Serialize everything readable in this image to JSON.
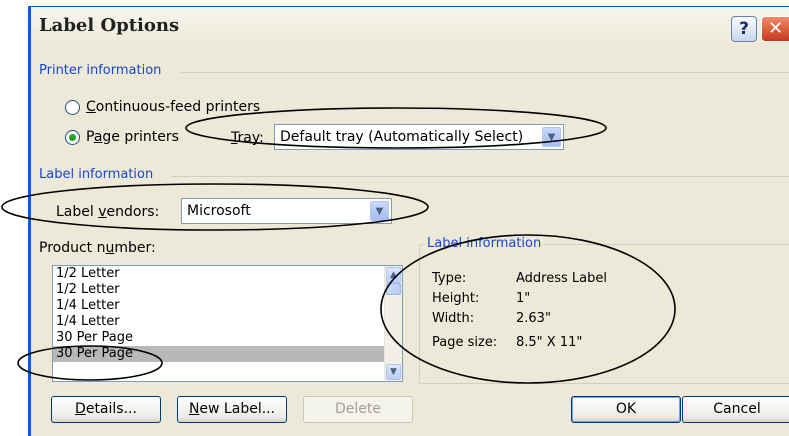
{
  "window": {
    "title": "Label Options"
  },
  "titlebar": {
    "help_glyph": "?",
    "close_glyph": "✕"
  },
  "printer": {
    "group_label": "Printer information",
    "continuous": {
      "pre": "",
      "accel": "C",
      "post": "ontinuous-feed printers",
      "checked": false
    },
    "page": {
      "pre": "P",
      "accel": "a",
      "post": "ge printers",
      "checked": true
    },
    "tray": {
      "accel": "T",
      "post": "ray:",
      "value": "Default tray (Automatically Select)"
    }
  },
  "labelinfo": {
    "group_label": "Label information",
    "vendors": {
      "pre": "Label ",
      "accel": "v",
      "post": "endors:",
      "value": "Microsoft"
    }
  },
  "product": {
    "label": {
      "pre": "Product n",
      "accel": "u",
      "post": "mber:"
    },
    "items": [
      "1/2 Letter",
      "1/2 Letter",
      "1/4 Letter",
      "1/4 Letter",
      "30 Per Page",
      "30 Per Page"
    ],
    "selected_index": 5
  },
  "info": {
    "title": "Label information",
    "rows": [
      {
        "key": "Type:",
        "value": "Address Label"
      },
      {
        "key": "Height:",
        "value": "1\""
      },
      {
        "key": "Width:",
        "value": "2.63\""
      },
      {
        "key": "Page size:",
        "value": "8.5\" X 11\""
      }
    ]
  },
  "buttons": {
    "details": {
      "accel": "D",
      "post": "etails..."
    },
    "new_label": {
      "accel": "N",
      "post": "ew Label..."
    },
    "delete": "Delete",
    "ok": "OK",
    "cancel": "Cancel"
  },
  "colors": {
    "group_text": "#1a46c9",
    "annotation": "#000000",
    "radio_dot": "#23a31f"
  }
}
